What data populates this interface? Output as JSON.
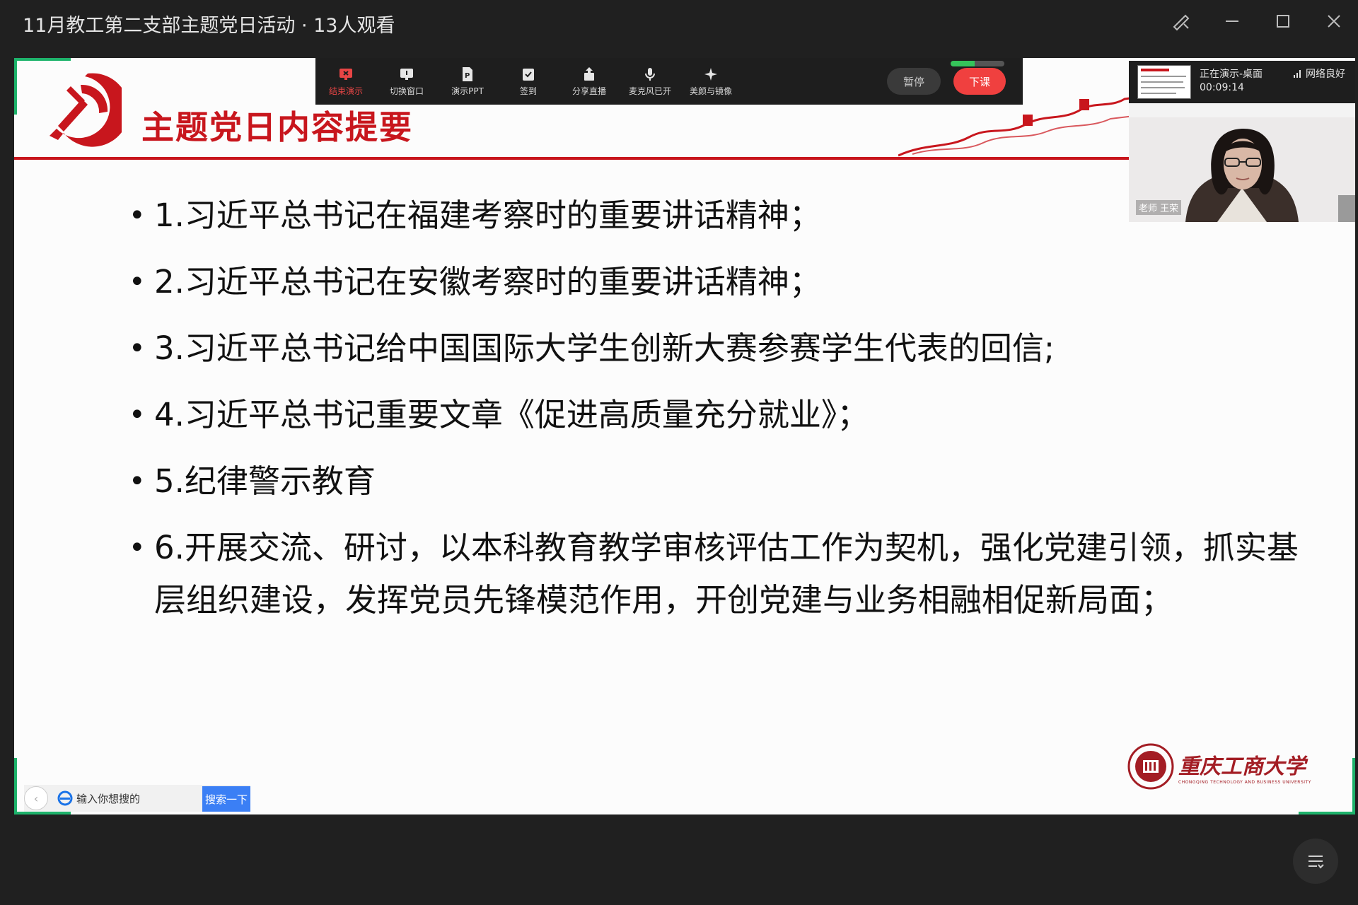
{
  "window": {
    "title": "11月教工第二支部主题党日活动 · 13人观看"
  },
  "toolbar": {
    "items": [
      {
        "label": "结束演示",
        "icon": "end-presentation-icon"
      },
      {
        "label": "切换窗口",
        "icon": "switch-window-icon"
      },
      {
        "label": "演示PPT",
        "icon": "ppt-icon"
      },
      {
        "label": "签到",
        "icon": "check-in-icon"
      },
      {
        "label": "分享直播",
        "icon": "share-icon"
      },
      {
        "label": "麦克风已开",
        "icon": "microphone-icon"
      },
      {
        "label": "美颜与镜像",
        "icon": "beauty-icon"
      }
    ],
    "pause_label": "暂停",
    "end_class_label": "下课",
    "mic_level": 0.45,
    "active_color": "#e84545",
    "end_color": "#f0403f"
  },
  "presenter": {
    "status": "正在演示-桌面",
    "elapsed": "00:09:14",
    "network": "网络良好",
    "cam_label": "老师 王荣"
  },
  "slide": {
    "title": "主题党日内容提要",
    "title_color": "#c8161d",
    "bullets": [
      "1.习近平总书记在福建考察时的重要讲话精神；",
      "2.习近平总书记在安徽考察时的重要讲话精神；",
      "3.习近平总书记给中国国际大学生创新大赛参赛学生代表的回信;",
      "4.习近平总书记重要文章《促进高质量充分就业》；",
      "5.纪律警示教育",
      "6.开展交流、研讨，以本科教育教学审核评估工作为契机，强化党建引领，抓实基层组织建设，发挥党员先锋模范作用，开创党建与业务相融相促新局面；"
    ],
    "logo_cn": "重庆工商大学",
    "logo_en": "CHONGQING TECHNOLOGY AND BUSINESS UNIVERSITY"
  },
  "browser_search": {
    "placeholder": "输入你想搜的",
    "button_label": "搜索一下"
  }
}
